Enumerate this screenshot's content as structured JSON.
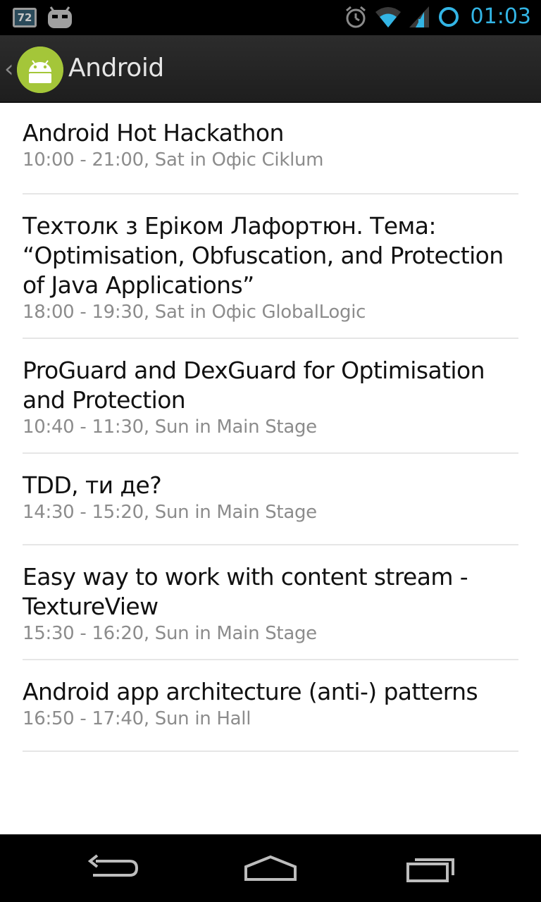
{
  "status_bar": {
    "notification_badge": "72",
    "time": "01:03",
    "accent_color": "#33b5e5",
    "icons": [
      "notification-72-icon",
      "cyanogenmod-icon",
      "alarm-icon",
      "wifi-icon",
      "signal-icon",
      "sync-circle-icon"
    ]
  },
  "action_bar": {
    "title": "Android",
    "logo_color": "#a4c639"
  },
  "sessions": [
    {
      "title": "Android Hot Hackathon",
      "subtitle": "10:00 - 21:00, Sat in Офіс Ciklum"
    },
    {
      "title": "Техтолк з Еріком Лафортюн. Тема: “Optimisation, Obfuscation, and Protection of Java Applications”",
      "subtitle": "18:00 - 19:30, Sat in Офіс GlobalLogic"
    },
    {
      "title": "ProGuard and DexGuard for Optimisation and Protection",
      "subtitle": "10:40 - 11:30, Sun in Main Stage"
    },
    {
      "title": "TDD, ти де?",
      "subtitle": "14:30 - 15:20, Sun in Main Stage"
    },
    {
      "title": "Easy way to work with content stream - TextureView",
      "subtitle": "15:30 - 16:20, Sun in Main Stage"
    },
    {
      "title": "Android app architecture (anti-) patterns",
      "subtitle": "16:50 - 17:40, Sun in Hall"
    }
  ],
  "nav_bar": {
    "icons": [
      "back-icon",
      "home-icon",
      "recent-apps-icon"
    ]
  }
}
